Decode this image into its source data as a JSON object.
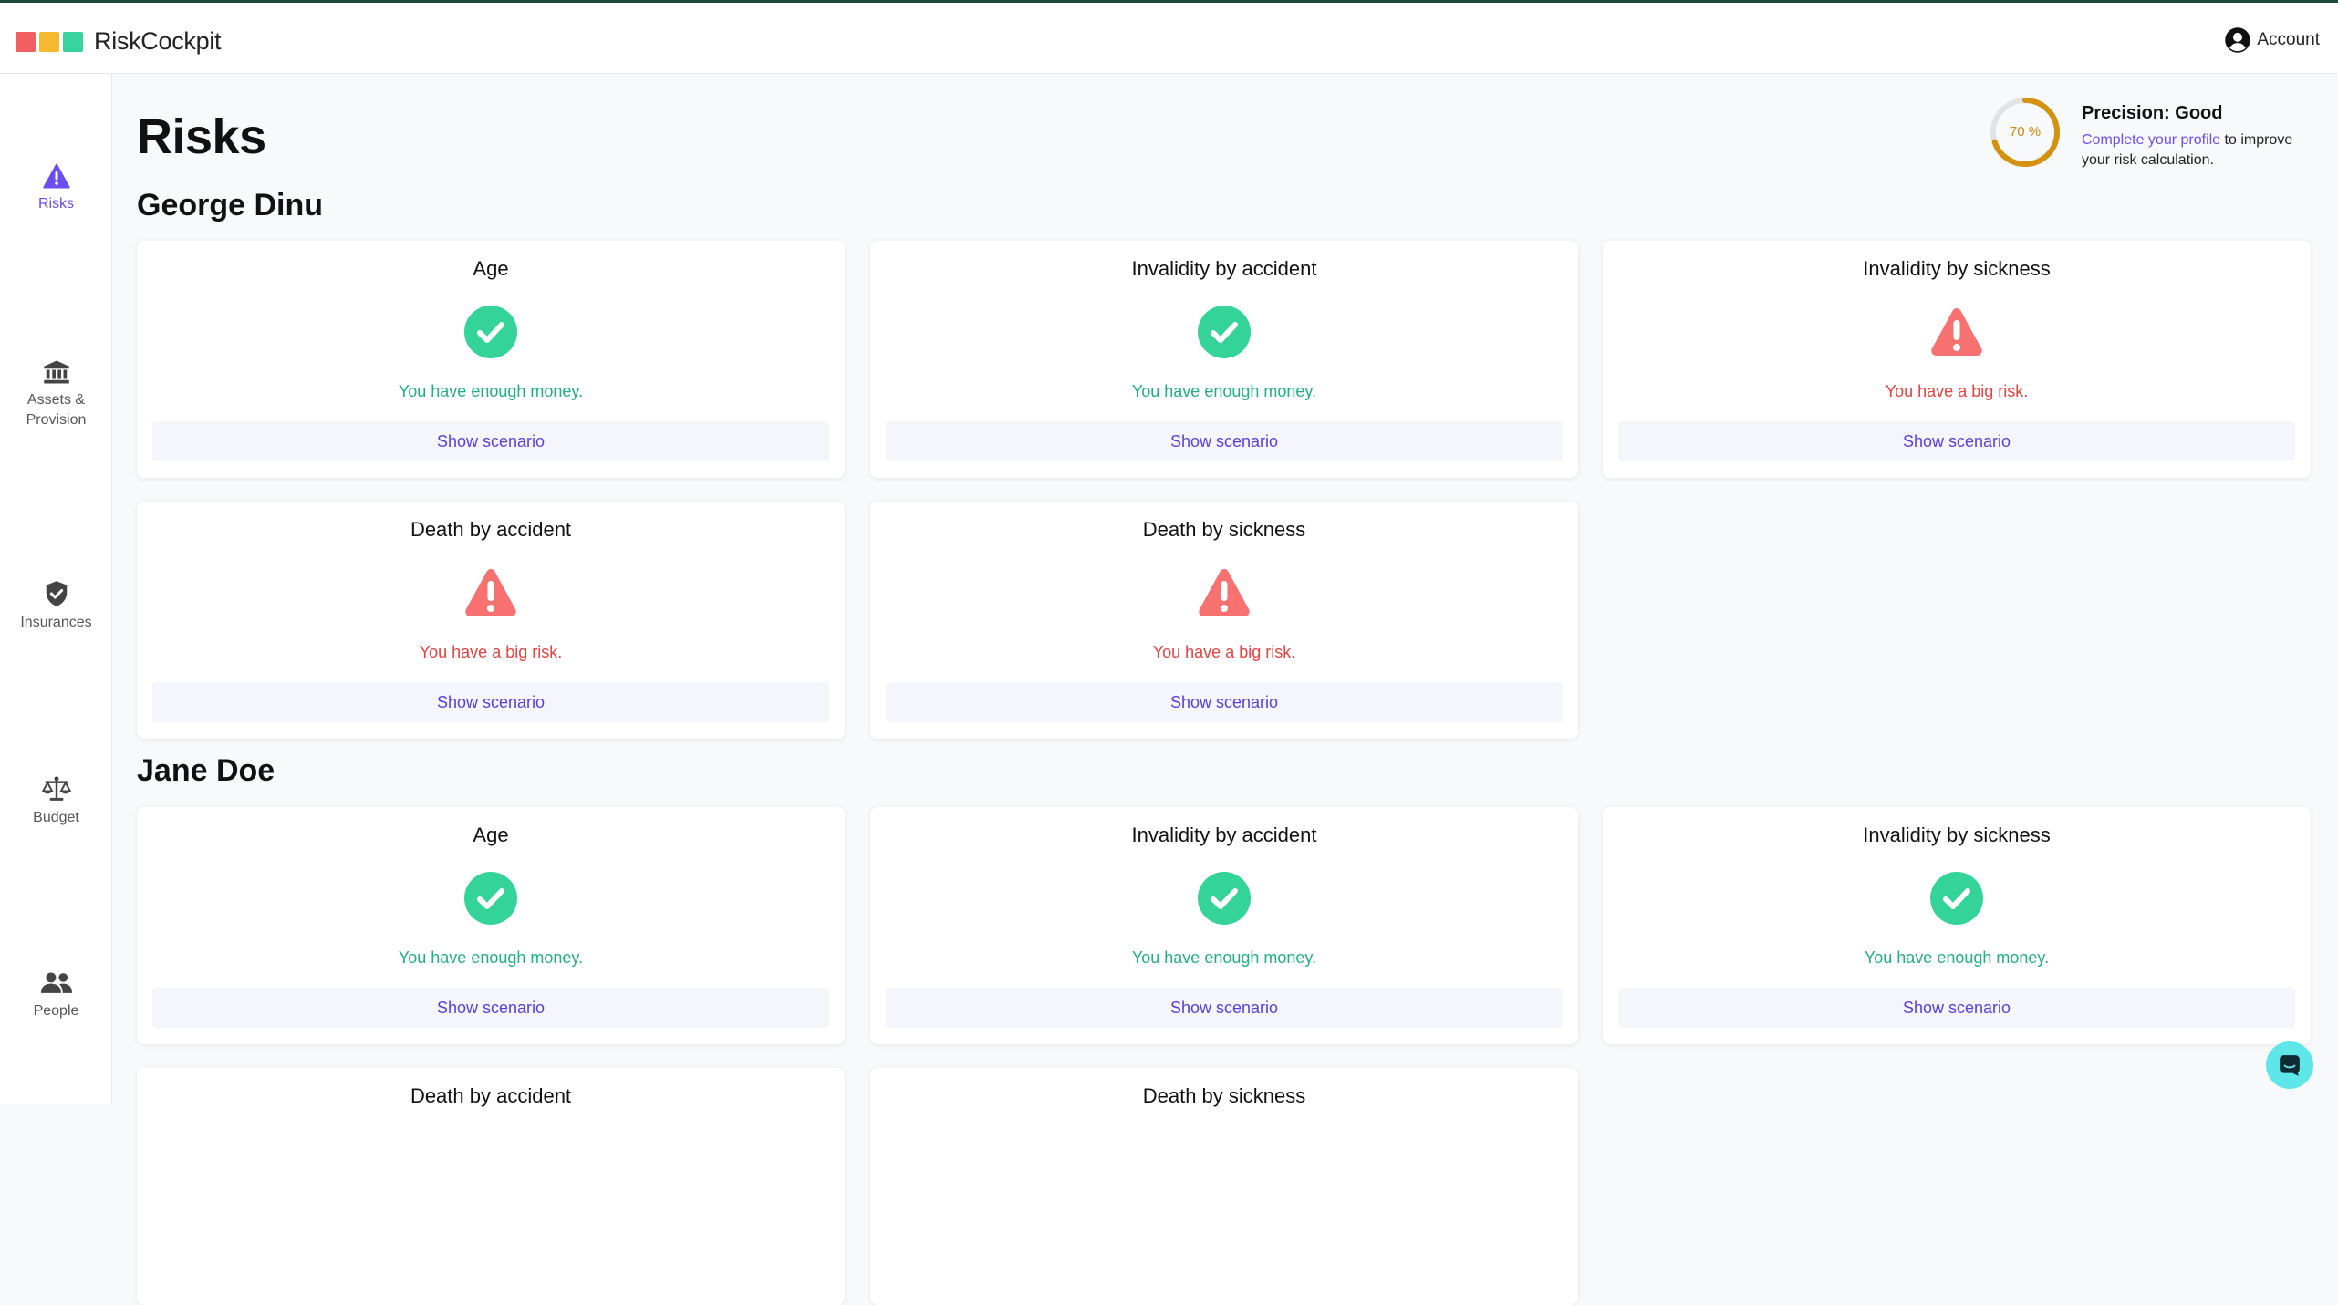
{
  "app": {
    "name": "RiskCockpit",
    "logo_colors": [
      "#f25f63",
      "#f5b82e",
      "#38d39f"
    ]
  },
  "header": {
    "account_label": "Account"
  },
  "sidebar": {
    "items": [
      {
        "label": "Risks",
        "icon": "warning-icon",
        "active": true
      },
      {
        "label": "Assets &\nProvision",
        "icon": "bank-icon",
        "active": false
      },
      {
        "label": "Insurances",
        "icon": "shield-check-icon",
        "active": false
      },
      {
        "label": "Budget",
        "icon": "scale-icon",
        "active": false
      },
      {
        "label": "People",
        "icon": "people-icon",
        "active": false
      }
    ]
  },
  "page": {
    "title": "Risks"
  },
  "precision": {
    "percent_label": "70 %",
    "value": 0.7,
    "title": "Precision: Good",
    "link_text": "Complete your profile",
    "desc_rest": " to improve your risk calculation."
  },
  "people": [
    {
      "name": "George Dinu",
      "risks": [
        {
          "title": "Age",
          "status": "ok",
          "message": "You have enough money.",
          "button": "Show scenario"
        },
        {
          "title": "Invalidity by accident",
          "status": "ok",
          "message": "You have enough money.",
          "button": "Show scenario"
        },
        {
          "title": "Invalidity by sickness",
          "status": "bad",
          "message": "You have a big risk.",
          "button": "Show scenario"
        },
        {
          "title": "Death by accident",
          "status": "bad",
          "message": "You have a big risk.",
          "button": "Show scenario"
        },
        {
          "title": "Death by sickness",
          "status": "bad",
          "message": "You have a big risk.",
          "button": "Show scenario"
        }
      ]
    },
    {
      "name": "Jane Doe",
      "risks": [
        {
          "title": "Age",
          "status": "ok",
          "message": "You have enough money.",
          "button": "Show scenario"
        },
        {
          "title": "Invalidity by accident",
          "status": "ok",
          "message": "You have enough money.",
          "button": "Show scenario"
        },
        {
          "title": "Invalidity by sickness",
          "status": "ok",
          "message": "You have enough money.",
          "button": "Show scenario"
        },
        {
          "title": "Death by accident"
        },
        {
          "title": "Death by sickness"
        }
      ]
    }
  ],
  "colors": {
    "accent": "#6c4ef0",
    "ok": "#34d399",
    "bad": "#f87171",
    "progress": "#d4920f"
  }
}
